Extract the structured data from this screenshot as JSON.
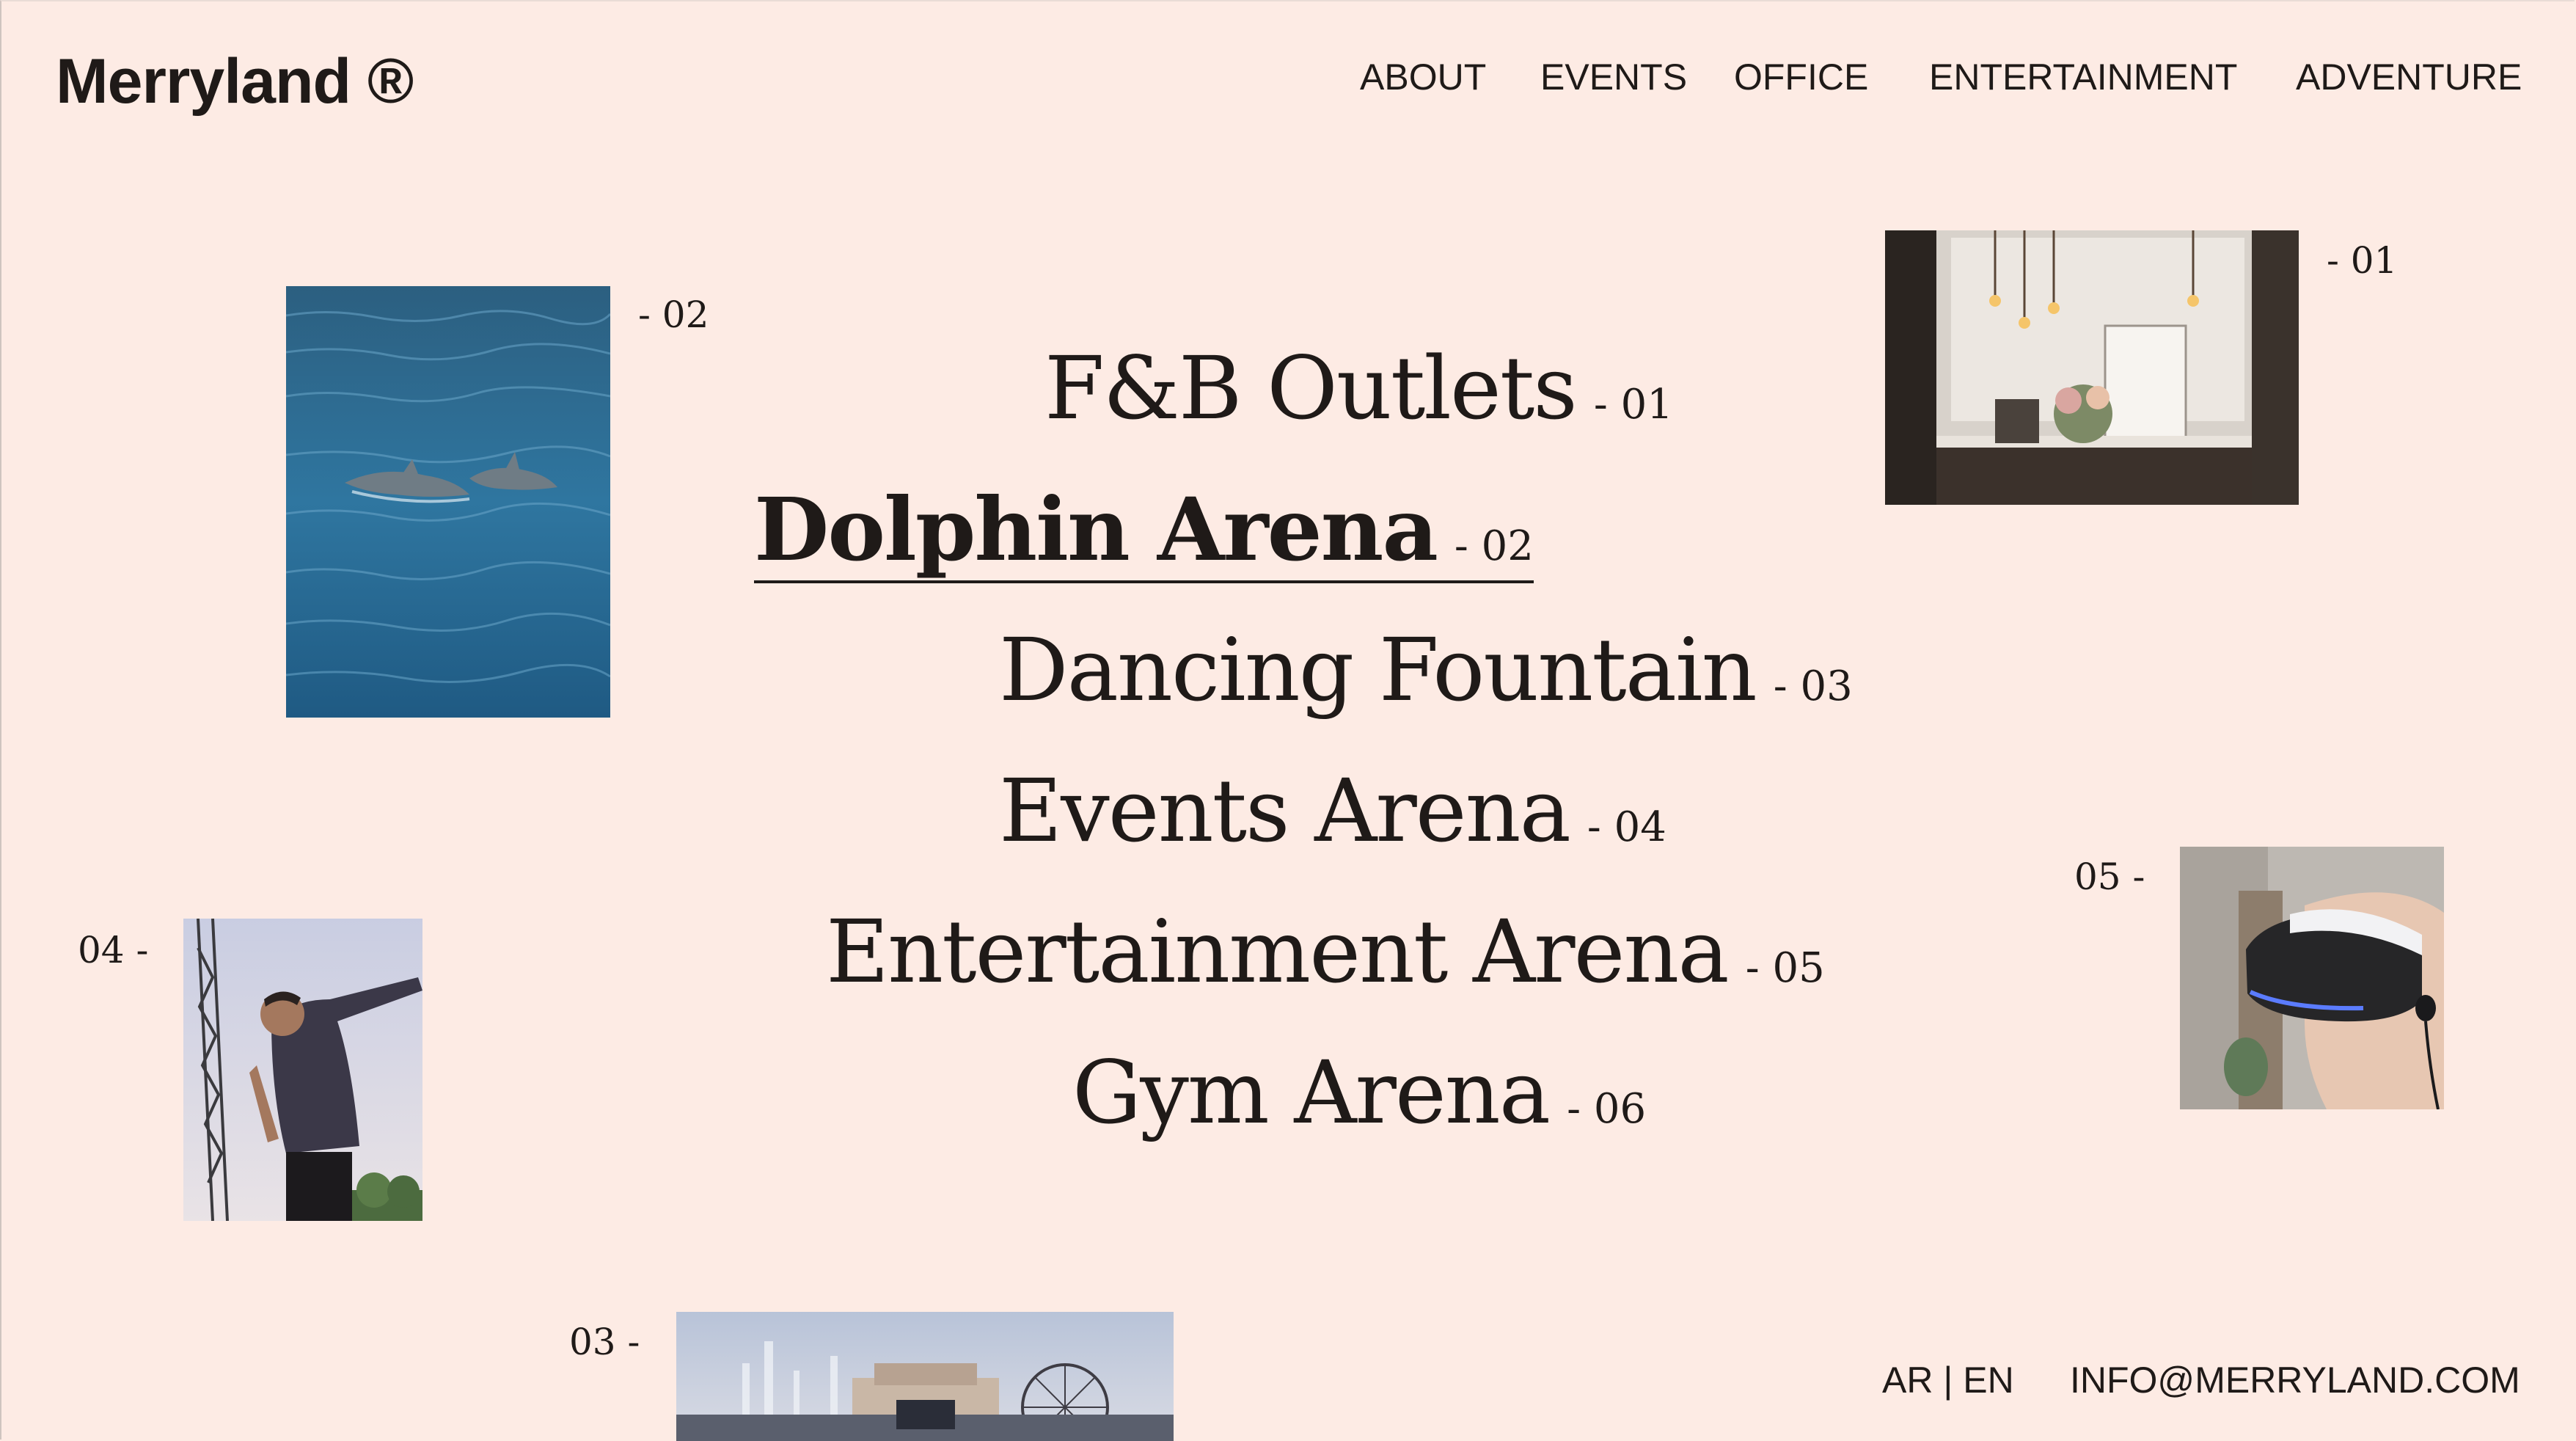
{
  "header": {
    "brand": "Merryland ®",
    "nav": [
      "ABOUT",
      "EVENTS",
      "OFFICE",
      "ENTERTAINMENT",
      "ADVENTURE"
    ]
  },
  "menu": [
    {
      "label": "F&B Outlets",
      "num": "- 01"
    },
    {
      "label": "Dolphin Arena",
      "num": "- 02",
      "active": true
    },
    {
      "label": "Dancing Fountain",
      "num": "- 03"
    },
    {
      "label": "Events Arena",
      "num": "- 04"
    },
    {
      "label": "Entertainment Arena",
      "num": "- 05"
    },
    {
      "label": "Gym Arena",
      "num": "- 06"
    }
  ],
  "photo_tags": {
    "cafe": "- 01",
    "dolphin": "- 02",
    "fountain": "03 -",
    "concert": "04 -",
    "vr": "05 -"
  },
  "footer": {
    "language": "AR | EN",
    "email": "INFO@MERRYLAND.COM"
  },
  "colors": {
    "background": "#fdebe4",
    "text": "#1f1a18"
  }
}
